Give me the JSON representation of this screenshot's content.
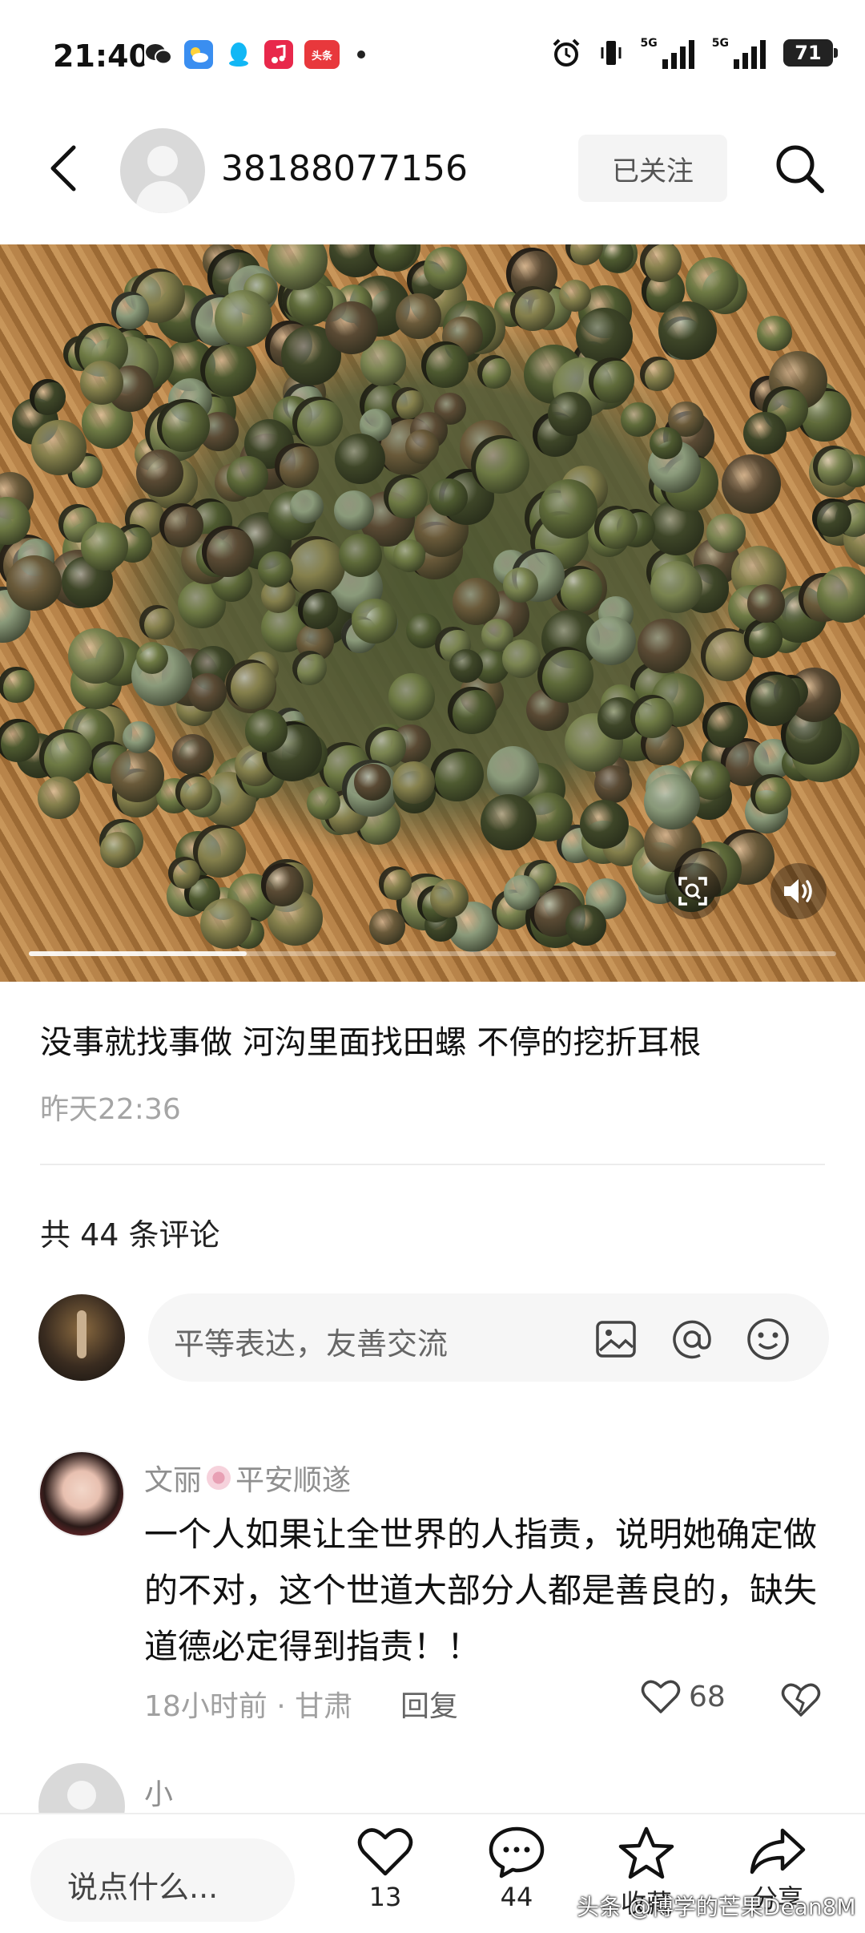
{
  "status_bar": {
    "time": "21:40",
    "app_badge_toutiao": "头条",
    "network_1": "5G",
    "network_2": "5G",
    "battery": "71"
  },
  "header": {
    "username": "38188077156",
    "follow_label": "已关注"
  },
  "video": {
    "progress": 0.27
  },
  "post": {
    "title": "没事就找事做  河沟里面找田螺  不停的挖折耳根",
    "time": "昨天22:36"
  },
  "comments_section": {
    "count_label": "共 44 条评论",
    "input_placeholder": "平等表达，友善交流"
  },
  "comments": [
    {
      "author": "文丽",
      "badge": "平安顺遂",
      "text": "一个人如果让全世界的人指责，说明她确定做的不对，这个世道大部分人都是善良的，缺失道德必定得到指责！！",
      "meta": "18小时前 · 甘肃",
      "reply_label": "回复",
      "likes": "68"
    },
    {
      "author": "小"
    }
  ],
  "bottom_bar": {
    "input_placeholder": "说点什么...",
    "like_count": "13",
    "comment_count": "44",
    "favorite_label": "收藏",
    "share_label": "分享"
  },
  "watermark": "头条 @博学的芒果Dean8M"
}
